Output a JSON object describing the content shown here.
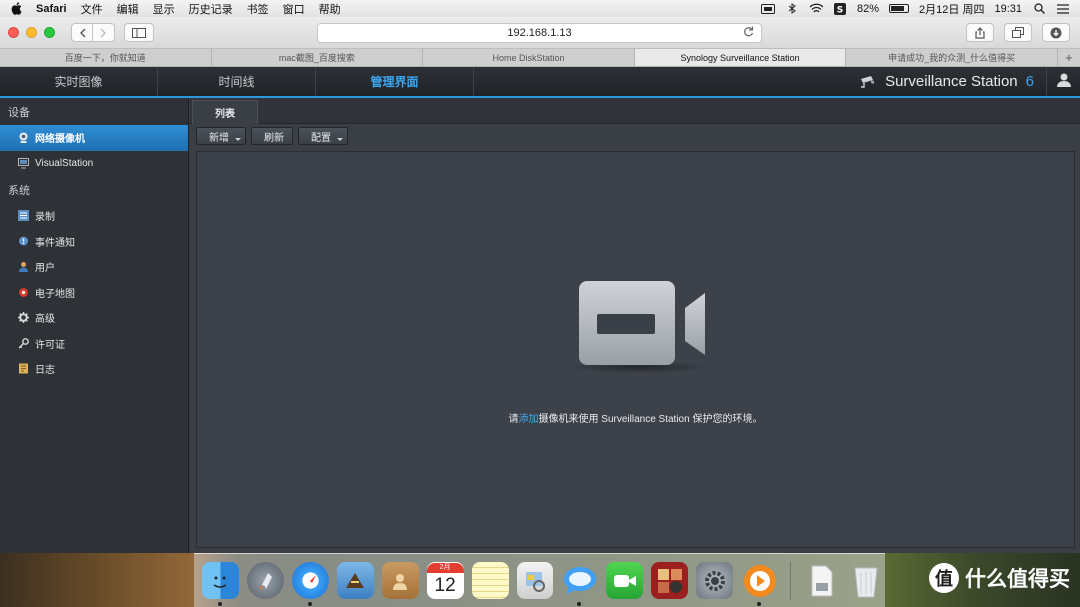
{
  "menubar": {
    "app_name": "Safari",
    "menus": [
      "文件",
      "编辑",
      "显示",
      "历史记录",
      "书签",
      "窗口",
      "帮助"
    ],
    "battery_percent": "82%",
    "battery_level": 0.82,
    "date": "2月12日 周四",
    "time": "19:31"
  },
  "browser": {
    "url": "192.168.1.13",
    "tabs": [
      {
        "label": "百度一下，你就知道",
        "active": false
      },
      {
        "label": "mac截图_百度搜索",
        "active": false
      },
      {
        "label": "Home DiskStation",
        "active": false
      },
      {
        "label": "Synology Surveillance Station",
        "active": true
      },
      {
        "label": "申请成功_我的众测_什么值得买",
        "active": false
      }
    ]
  },
  "app": {
    "nav": [
      "实时图像",
      "时间线",
      "管理界面"
    ],
    "active_nav": 2,
    "brand_name": "Surveillance Station",
    "brand_version": "6",
    "accent_color": "#3da5ee"
  },
  "sidebar": {
    "sections": [
      {
        "heading": "设备",
        "items": [
          {
            "label": "网络摄像机",
            "icon": "webcam-icon",
            "active": true
          },
          {
            "label": "VisualStation",
            "icon": "monitor-icon",
            "active": false
          }
        ]
      },
      {
        "heading": "系统",
        "items": [
          {
            "label": "录制",
            "icon": "recording-list-icon",
            "active": false
          },
          {
            "label": "事件通知",
            "icon": "notification-icon",
            "active": false
          },
          {
            "label": "用户",
            "icon": "user-icon",
            "active": false
          },
          {
            "label": "电子地图",
            "icon": "map-pin-icon",
            "active": false
          },
          {
            "label": "高级",
            "icon": "gear-icon",
            "active": false
          },
          {
            "label": "许可证",
            "icon": "key-icon",
            "active": false
          },
          {
            "label": "日志",
            "icon": "log-icon",
            "active": false
          }
        ]
      }
    ]
  },
  "main": {
    "tab_label": "列表",
    "actions": [
      {
        "label": "新增",
        "dropdown": true
      },
      {
        "label": "刷新",
        "dropdown": false
      },
      {
        "label": "配置",
        "dropdown": true
      }
    ],
    "empty_prefix": "请",
    "empty_link": "添加",
    "empty_suffix": "摄像机来使用 Surveillance Station 保护您的环境。"
  },
  "dock": {
    "calendar_month": "2月",
    "calendar_day": "12",
    "apps": [
      "finder-icon",
      "launchpad-icon",
      "safari-icon",
      "mail-icon",
      "contacts-icon",
      "calendar-icon",
      "notes-icon",
      "preview-icon",
      "messages-icon",
      "facetime-icon",
      "photo-booth-icon",
      "system-preferences-icon",
      "media-player-icon",
      "downloads-stack-icon",
      "trash-icon"
    ]
  },
  "watermark": {
    "logo_glyph": "值",
    "text": "什么值得买"
  }
}
